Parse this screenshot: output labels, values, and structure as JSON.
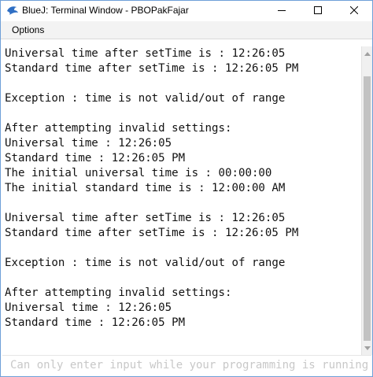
{
  "window": {
    "title": "BlueJ: Terminal Window - PBOPakFajar",
    "icon": "bluej-bird-icon",
    "controls": [
      "minimize-icon",
      "maximize-icon",
      "close-icon"
    ]
  },
  "menubar": {
    "items": [
      {
        "label": "Options"
      }
    ]
  },
  "terminal": {
    "lines": [
      "Universal time after setTime is : 12:26:05",
      "Standard time after setTime is : 12:26:05 PM",
      "",
      "Exception : time is not valid/out of range",
      "",
      "After attempting invalid settings:",
      "Universal time : 12:26:05",
      "Standard time : 12:26:05 PM",
      "The initial universal time is : 00:00:00",
      "The initial standard time is : 12:00:00 AM",
      "",
      "Universal time after setTime is : 12:26:05",
      "Standard time after setTime is : 12:26:05 PM",
      "",
      "Exception : time is not valid/out of range",
      "",
      "After attempting invalid settings:",
      "Universal time : 12:26:05",
      "Standard time : 12:26:05 PM"
    ]
  },
  "input": {
    "placeholder": "Can only enter input while your programming is running",
    "value": ""
  },
  "scrollbar": {
    "up_icon": "scroll-up-arrow-icon",
    "down_icon": "scroll-down-arrow-icon"
  },
  "colors": {
    "window_border": "#6f9fd8",
    "menubar_bg": "#f3f3f3",
    "text": "#111111",
    "placeholder": "#c8c8c8"
  }
}
